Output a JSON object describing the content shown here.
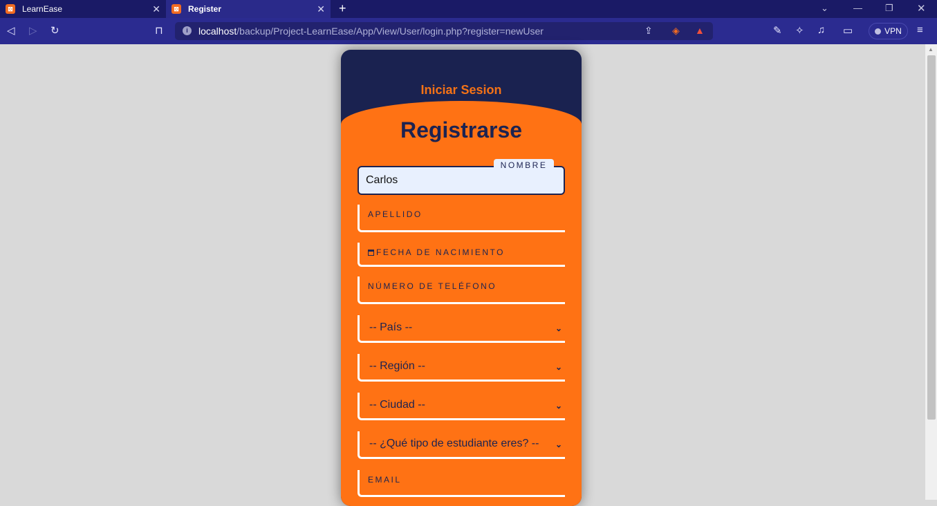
{
  "browser": {
    "tabs": [
      {
        "title": "LearnEase",
        "active": false
      },
      {
        "title": "Register",
        "active": true
      }
    ],
    "url_host": "localhost",
    "url_path": "/backup/Project-LearnEase/App/View/User/login.php?register=newUser",
    "vpn_label": "VPN"
  },
  "login": {
    "title": "Iniciar Sesion"
  },
  "register": {
    "title": "Registrarse",
    "name_label": "NOMBRE",
    "name_value": "Carlos",
    "apellido_label": "APELLIDO",
    "fecha_label": "FECHA DE NACIMIENTO",
    "telefono_label": "NÚMERO DE TELÉFONO",
    "pais": "-- País --",
    "region": "-- Región --",
    "ciudad": "-- Ciudad --",
    "tipo": "-- ¿Qué tipo de estudiante eres? --",
    "email_label": "EMAIL"
  },
  "colors": {
    "navy": "#1c2351",
    "orange": "#ff7214",
    "browser": "#2b2b90"
  }
}
